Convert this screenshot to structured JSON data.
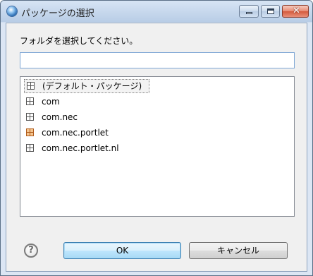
{
  "window": {
    "title": "パッケージの選択"
  },
  "dialog": {
    "prompt": "フォルダを選択してください。",
    "filter_value": "",
    "packages": [
      {
        "label": "(デフォルト・パッケージ)",
        "icon": "package-icon",
        "selected": true
      },
      {
        "label": "com",
        "icon": "package-icon",
        "selected": false
      },
      {
        "label": "com.nec",
        "icon": "package-icon",
        "selected": false
      },
      {
        "label": "com.nec.portlet",
        "icon": "portlet-package-icon",
        "selected": false
      },
      {
        "label": "com.nec.portlet.nl",
        "icon": "package-icon",
        "selected": false
      }
    ]
  },
  "buttons": {
    "help_glyph": "?",
    "ok_label": "OK",
    "cancel_label": "キャンセル"
  },
  "titlebar": {
    "close_glyph": "✕"
  },
  "colors": {
    "titlebar": "#c9daee",
    "client_bg": "#f0f0f0",
    "ok_button": "#bee6fd",
    "portlet_icon": "#f4c58f"
  }
}
